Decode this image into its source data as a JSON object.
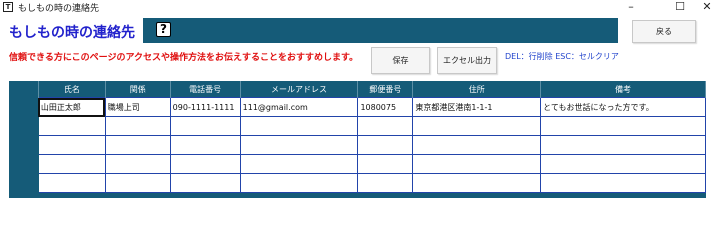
{
  "window": {
    "title": "もしもの時の連絡先",
    "icon_glyph": "T",
    "minimize": "–",
    "maximize": "☐",
    "close": "✕"
  },
  "form_title": "もしもの時の連絡先",
  "help_icon": "?",
  "buttons": {
    "back": "戻る",
    "save": "保存",
    "excel": "エクセル出力"
  },
  "notice": "信頼できる方にこのページのアクセスや操作方法をお伝えすることをおすすめします。",
  "hint": "DEL：行削除 ESC：セルクリア",
  "colors": {
    "accent": "#155b78",
    "title": "#2222cc",
    "notice": "#e01010",
    "hint": "#2244cc"
  },
  "table": {
    "headers": [
      "氏名",
      "関係",
      "電話番号",
      "メールアドレス",
      "郵便番号",
      "住所",
      "備考"
    ],
    "rows": [
      [
        "山田正太郎",
        "職場上司",
        "090-1111-1111",
        "111@gmail.com",
        "1080075",
        "東京都港区港南1-1-1",
        "とてもお世話になった方です。"
      ],
      [
        "",
        "",
        "",
        "",
        "",
        "",
        ""
      ],
      [
        "",
        "",
        "",
        "",
        "",
        "",
        ""
      ],
      [
        "",
        "",
        "",
        "",
        "",
        "",
        ""
      ],
      [
        "",
        "",
        "",
        "",
        "",
        "",
        ""
      ]
    ]
  }
}
